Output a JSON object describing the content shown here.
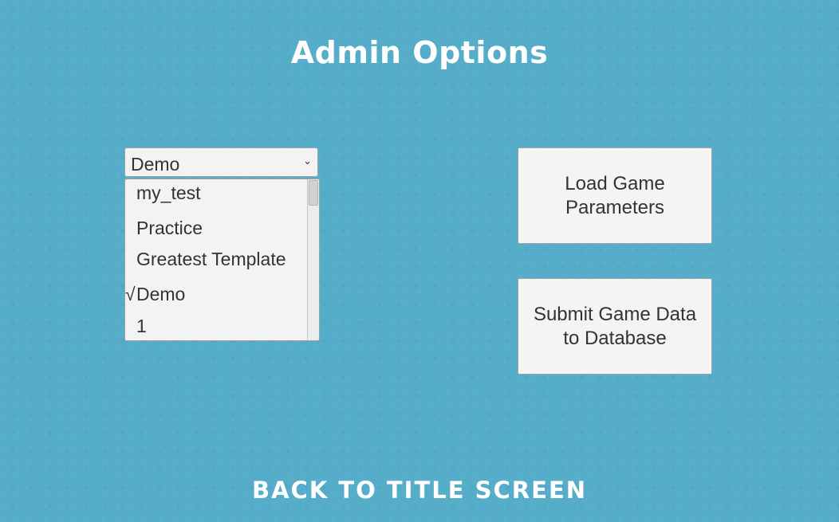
{
  "title": "Admin Options",
  "dropdown": {
    "selected": "Demo",
    "arrow": "⌄",
    "options": [
      {
        "label": "my_test",
        "checked": false
      },
      {
        "label": "Practice",
        "checked": false
      },
      {
        "label": "Greatest Template",
        "checked": false
      },
      {
        "label": "Demo",
        "checked": true
      },
      {
        "label": "1",
        "checked": false
      }
    ],
    "check_mark": "√"
  },
  "buttons": {
    "load": "Load Game\nParameters",
    "submit": "Submit Game Data\nto Database"
  },
  "back_link": "Back to Title Screen",
  "colors": {
    "background": "#55adc9",
    "panel": "#f3f3f3",
    "text": "#333333",
    "title": "#ffffff"
  }
}
